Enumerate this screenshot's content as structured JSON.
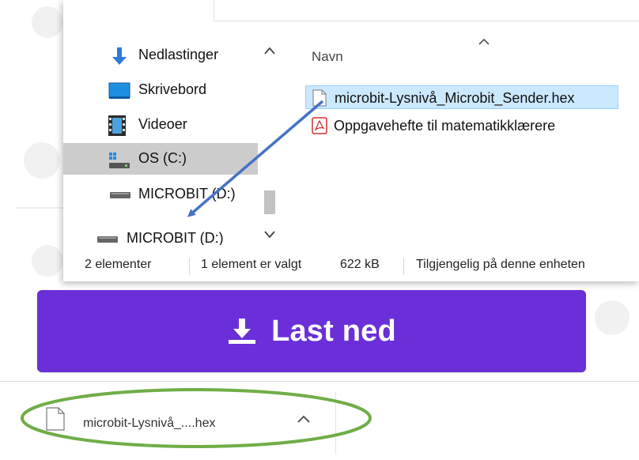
{
  "explorer": {
    "nav_items": [
      {
        "label": "Nedlastinger",
        "icon": "download-arrow-icon"
      },
      {
        "label": "Skrivebord",
        "icon": "desktop-icon"
      },
      {
        "label": "Videoer",
        "icon": "film-strip-icon"
      },
      {
        "label": "OS (C:)",
        "icon": "windows-drive-icon",
        "selected": true
      },
      {
        "label": "MICROBIT (D:)",
        "icon": "drive-icon"
      },
      {
        "label": "MICROBIT (D:)",
        "icon": "drive-icon"
      }
    ],
    "column_header": "Navn",
    "files": [
      {
        "name": "microbit-Lysnivå_Microbit_Sender.hex",
        "icon": "document-icon",
        "selected": true
      },
      {
        "name": "Oppgavehefte til matematikklærere",
        "icon": "pdf-icon",
        "selected": false
      }
    ],
    "status": {
      "item_count": "2 elementer",
      "selection": "1 element er valgt",
      "size": "622 kB",
      "availability": "Tilgjengelig på denne enheten"
    }
  },
  "download_button": {
    "label": "Last ned",
    "icon": "download-tray-icon",
    "color": "#6a2fd8"
  },
  "download_bar": {
    "filename": "microbit-Lysnivå_....hex",
    "icon": "document-icon"
  },
  "annotations": {
    "arrow_color": "#4472c4",
    "ellipse_color": "#70ad47"
  }
}
